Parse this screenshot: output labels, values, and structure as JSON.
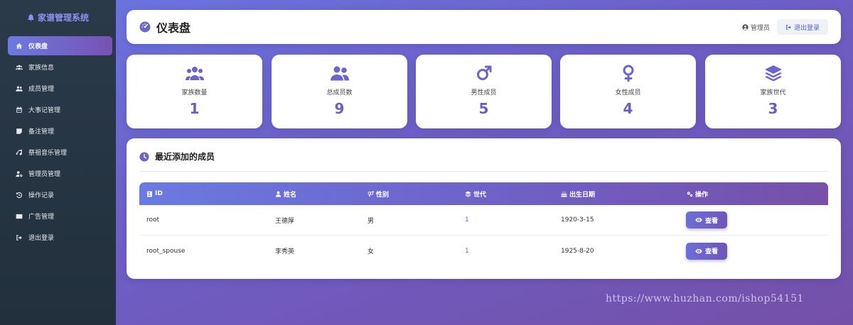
{
  "sidebar": {
    "brand": "家谱管理系统",
    "items": [
      {
        "label": "仪表盘",
        "icon": "home-icon",
        "active": true
      },
      {
        "label": "家族信息",
        "icon": "users-icon"
      },
      {
        "label": "成员管理",
        "icon": "user-friends-icon"
      },
      {
        "label": "大事记管理",
        "icon": "calendar-icon"
      },
      {
        "label": "备注管理",
        "icon": "note-icon"
      },
      {
        "label": "祭祖音乐管理",
        "icon": "music-icon"
      },
      {
        "label": "管理员管理",
        "icon": "user-cog-icon"
      },
      {
        "label": "操作记录",
        "icon": "history-icon"
      },
      {
        "label": "广告管理",
        "icon": "ad-icon"
      },
      {
        "label": "退出登录",
        "icon": "sign-out-icon"
      }
    ]
  },
  "header": {
    "title": "仪表盘",
    "user_label": "管理员",
    "logout_label": "退出登录"
  },
  "stats": [
    {
      "label": "家族数量",
      "value": "1",
      "icon": "users-icon"
    },
    {
      "label": "总成员数",
      "value": "9",
      "icon": "user-friends-icon"
    },
    {
      "label": "男性成员",
      "value": "5",
      "icon": "mars-icon"
    },
    {
      "label": "女性成员",
      "value": "4",
      "icon": "venus-icon"
    },
    {
      "label": "家族世代",
      "value": "3",
      "icon": "layers-icon"
    }
  ],
  "recent": {
    "title": "最近添加的成员",
    "columns": [
      "ID",
      "姓名",
      "性别",
      "世代",
      "出生日期",
      "操作"
    ],
    "rows": [
      {
        "id": "root",
        "name": "王德厚",
        "gender": "男",
        "generation": "1",
        "birth": "1920-3-15",
        "action": "查看"
      },
      {
        "id": "root_spouse",
        "name": "李秀英",
        "gender": "女",
        "generation": "1",
        "birth": "1925-8-20",
        "action": "查看"
      }
    ]
  },
  "watermark": "https://www.huzhan.com/ishop54151",
  "colors": {
    "accent": "#6b64cc",
    "sidebar_bg": "#2b3a49"
  }
}
